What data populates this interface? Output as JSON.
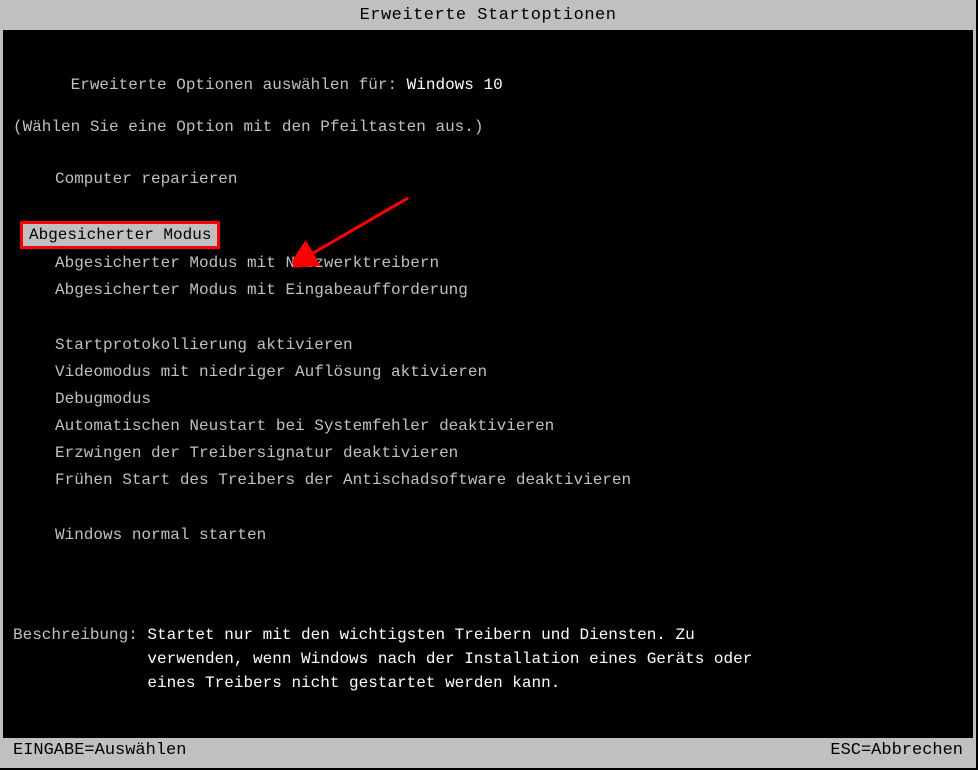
{
  "title": "Erweiterte Startoptionen",
  "header": {
    "prompt": "Erweiterte Optionen auswählen für: ",
    "os": "Windows 10",
    "hint": "(Wählen Sie eine Option mit den Pfeiltasten aus.)"
  },
  "groups": [
    {
      "items": [
        {
          "label": "Computer reparieren",
          "selected": false
        }
      ]
    },
    {
      "items": [
        {
          "label": "Abgesicherter Modus",
          "selected": true
        },
        {
          "label": "Abgesicherter Modus mit Netzwerktreibern",
          "selected": false
        },
        {
          "label": "Abgesicherter Modus mit Eingabeaufforderung",
          "selected": false
        }
      ]
    },
    {
      "items": [
        {
          "label": "Startprotokollierung aktivieren",
          "selected": false
        },
        {
          "label": "Videomodus mit niedriger Auflösung aktivieren",
          "selected": false
        },
        {
          "label": "Debugmodus",
          "selected": false
        },
        {
          "label": "Automatischen Neustart bei Systemfehler deaktivieren",
          "selected": false
        },
        {
          "label": "Erzwingen der Treibersignatur deaktivieren",
          "selected": false
        },
        {
          "label": "Frühen Start des Treibers der Antischadsoftware deaktivieren",
          "selected": false
        }
      ]
    },
    {
      "items": [
        {
          "label": "Windows normal starten",
          "selected": false
        }
      ]
    }
  ],
  "description": {
    "label": "Beschreibung: ",
    "line1": "Startet nur mit den wichtigsten Treibern und Diensten. Zu",
    "line2": "verwenden, wenn Windows nach der Installation eines Geräts oder",
    "line3": "eines Treibers nicht gestartet werden kann."
  },
  "footer": {
    "enter": "EINGABE=Auswählen",
    "esc": "ESC=Abbrechen"
  },
  "annotation": {
    "arrow_color": "#ff0000"
  }
}
